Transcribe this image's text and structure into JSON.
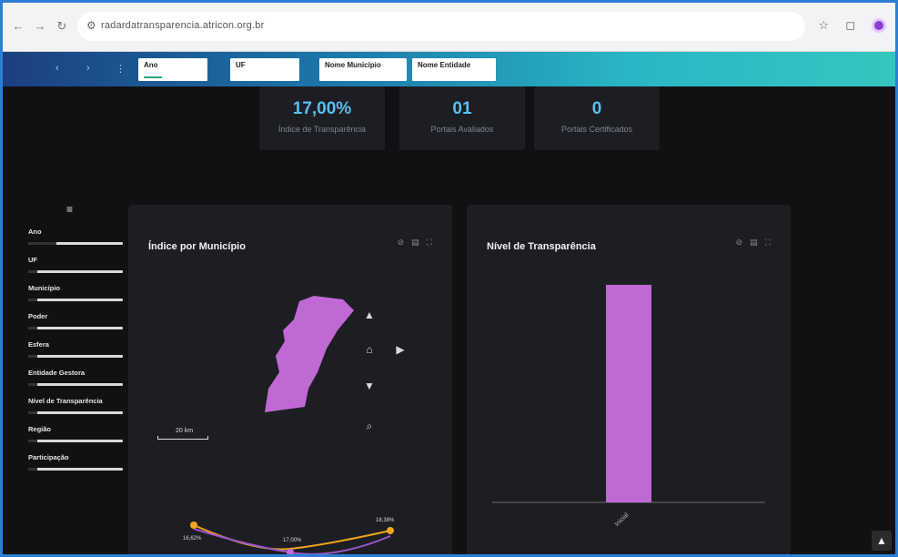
{
  "browser": {
    "url": "radardatransparencia.atricon.org.br",
    "icons": [
      "back-icon",
      "forward-icon",
      "reload-icon",
      "star-icon",
      "extension-icon",
      "profile-icon"
    ]
  },
  "filters": [
    {
      "label": "Ano",
      "value": ""
    },
    {
      "label": "UF",
      "value": ""
    },
    {
      "label": "Nome Município",
      "value": ""
    },
    {
      "label": "Nome Entidade",
      "value": ""
    }
  ],
  "kpis": [
    {
      "value": "17,00%",
      "label": "Índice de Transparência"
    },
    {
      "value": "01",
      "label": "Portais Avaliados"
    },
    {
      "value": "0",
      "label": "Portais Certificados"
    }
  ],
  "sidebar": {
    "items": [
      {
        "label": "Ano",
        "fill": 0.3
      },
      {
        "label": "UF",
        "fill": 0.1
      },
      {
        "label": "Município",
        "fill": 0.1
      },
      {
        "label": "Poder",
        "fill": 0.1
      },
      {
        "label": "Esfera",
        "fill": 0.1
      },
      {
        "label": "Entidade Gestora",
        "fill": 0.1
      },
      {
        "label": "Nível de Transparência",
        "fill": 0.1
      },
      {
        "label": "Região",
        "fill": 0.1
      },
      {
        "label": "Participação",
        "fill": 0.1
      }
    ]
  },
  "map_panel": {
    "title": "Índice por Município",
    "scale_label": "20 km",
    "region_color": "#c069d4",
    "line_labels": [
      "16,62%",
      "17,00%",
      "18,38%"
    ]
  },
  "bar_panel": {
    "title": "Nível de Transparência",
    "bar_color": "#c069d4"
  },
  "chart_data": {
    "type": "bar",
    "categories": [
      "Inicial"
    ],
    "values": [
      1
    ],
    "title": "Nível de Transparência",
    "xlabel": "",
    "ylabel": "",
    "ylim": [
      0,
      1.1
    ],
    "grid": false
  },
  "colors": {
    "accent": "#58c0f0",
    "purple": "#c069d4",
    "orange": "#f0a51e",
    "panel_bg": "#1d1e23",
    "page_bg": "#111114"
  }
}
